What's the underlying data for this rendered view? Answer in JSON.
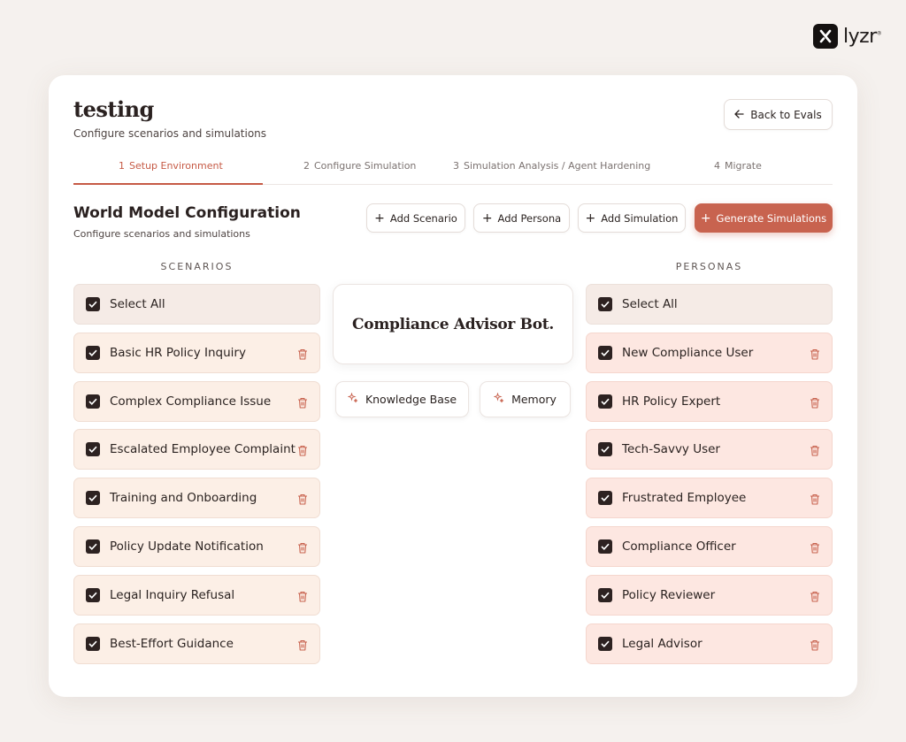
{
  "brand": {
    "name": "lyzr",
    "mark": "®"
  },
  "page": {
    "title": "testing",
    "subtitle": "Configure scenarios and simulations",
    "back_label": "Back to Evals"
  },
  "steps": [
    {
      "num": "1",
      "label": "Setup Environment",
      "active": true
    },
    {
      "num": "2",
      "label": "Configure Simulation",
      "active": false
    },
    {
      "num": "3",
      "label": "Simulation Analysis / Agent Hardening",
      "active": false
    },
    {
      "num": "4",
      "label": "Migrate",
      "active": false
    }
  ],
  "section": {
    "title": "World Model Configuration",
    "subtitle": "Configure scenarios and simulations"
  },
  "actions": {
    "add_scenario": "Add Scenario",
    "add_persona": "Add Persona",
    "add_simulation": "Add Simulation",
    "generate": "Generate Simulations"
  },
  "scenarios": {
    "heading": "SCENARIOS",
    "select_all": "Select All",
    "items": [
      "Basic HR Policy Inquiry",
      "Complex Compliance Issue",
      "Escalated Employee Complaint",
      "Training and Onboarding",
      "Policy Update Notification",
      "Legal Inquiry Refusal",
      "Best-Effort Guidance"
    ]
  },
  "personas": {
    "heading": "PERSONAS",
    "select_all": "Select All",
    "items": [
      "New Compliance User",
      "HR Policy Expert",
      "Tech-Savvy User",
      "Frustrated Employee",
      "Compliance Officer",
      "Policy Reviewer",
      "Legal Advisor"
    ]
  },
  "agent": {
    "name": "Compliance Advisor Bot.",
    "tools": [
      "Knowledge Base",
      "Memory"
    ]
  },
  "colors": {
    "accent": "#c8634f",
    "active_step": "#c65a45",
    "scenario_row": "#fcefe6",
    "persona_row": "#fde7e1",
    "checkbox": "#2d2221"
  }
}
